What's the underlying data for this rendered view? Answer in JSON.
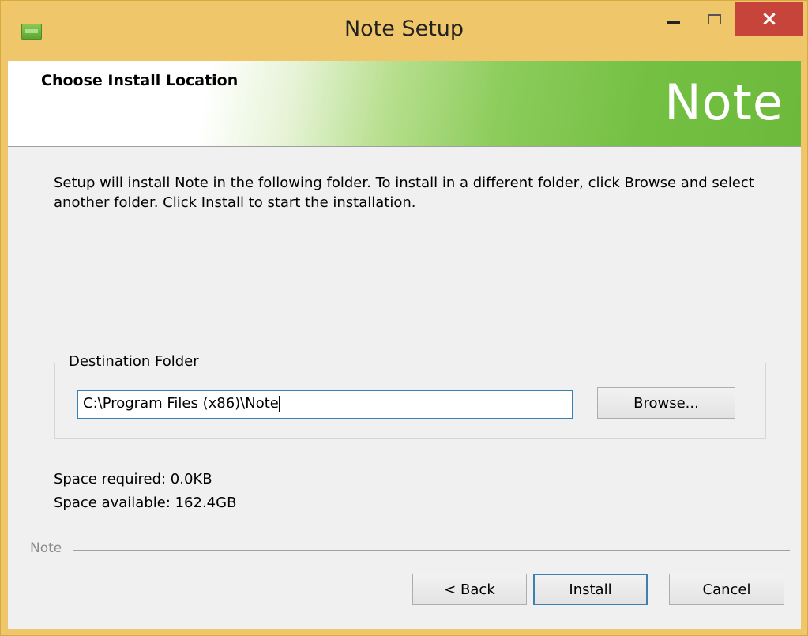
{
  "window": {
    "title": "Note Setup",
    "controls": {
      "minimize": "minimize",
      "maximize": "maximize",
      "close": "×"
    }
  },
  "banner": {
    "title": "Choose Install Location",
    "logo_text": "Note"
  },
  "content": {
    "intro": "Setup will install Note in the following folder. To install in a different folder, click Browse and select another folder. Click Install to start the installation.",
    "destination": {
      "legend": "Destination Folder",
      "path": "C:\\Program Files (x86)\\Note",
      "browse_label": "Browse..."
    },
    "space_required": "Space required: 0.0KB",
    "space_available": "Space available: 162.4GB"
  },
  "footer": {
    "brand": "Note",
    "back_label": "< Back",
    "install_label": "Install",
    "cancel_label": "Cancel"
  },
  "colors": {
    "title_bar": "#f0c66a",
    "close_button": "#c7443a",
    "banner_green": "#6cb93c",
    "focus_blue": "#3c7fb1"
  }
}
